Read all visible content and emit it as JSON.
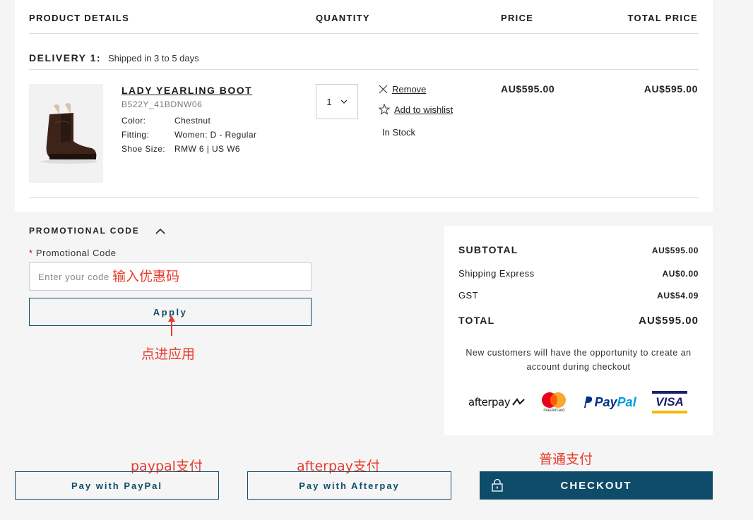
{
  "table_headers": {
    "product_details": "PRODUCT DETAILS",
    "quantity": "QUANTITY",
    "price": "PRICE",
    "total_price": "TOTAL PRICE"
  },
  "delivery": {
    "label": "DELIVERY 1:",
    "note": "Shipped in 3 to 5 days"
  },
  "product": {
    "name": "LADY YEARLING BOOT",
    "sku": "B522Y_41BDNW06",
    "attributes": [
      {
        "key": "Color:",
        "value": "Chestnut"
      },
      {
        "key": "Fitting:",
        "value": "Women: D - Regular"
      },
      {
        "key": "Shoe Size:",
        "value": "RMW 6 | US W6"
      }
    ],
    "quantity": "1",
    "remove_label": "Remove",
    "wishlist_label": "Add to wishlist",
    "stock_status": "In Stock",
    "price": "AU$595.00",
    "total_price": "AU$595.00"
  },
  "promo": {
    "title": "PROMOTIONAL CODE",
    "required_mark": "*",
    "label": "Promotional Code",
    "placeholder": "Enter your code",
    "apply_label": "Apply"
  },
  "summary": {
    "subtotal_label": "SUBTOTAL",
    "subtotal_value": "AU$595.00",
    "shipping_label": "Shipping Express",
    "shipping_value": "AU$0.00",
    "gst_label": "GST",
    "gst_value": "AU$54.09",
    "total_label": "TOTAL",
    "total_value": "AU$595.00",
    "note": "New customers will have the opportunity to create an account during checkout",
    "payment_logos": {
      "afterpay": "afterpay",
      "mastercard": "mastercard",
      "paypal_pay": "Pay",
      "paypal_pal": "Pal",
      "visa": "VISA"
    }
  },
  "buttons": {
    "paypal": "Pay with PayPal",
    "afterpay": "Pay with Afterpay",
    "checkout": "CHECKOUT"
  },
  "annotations": {
    "enter_code": "输入优惠码",
    "click_apply": "点进应用",
    "paypal_pay": "paypal支付",
    "afterpay_pay": "afterpay支付",
    "normal_pay": "普通支付"
  },
  "colors": {
    "brand": "#0f4c6a",
    "annotation": "#e83a2c",
    "page_bg": "#f5f5f5"
  }
}
